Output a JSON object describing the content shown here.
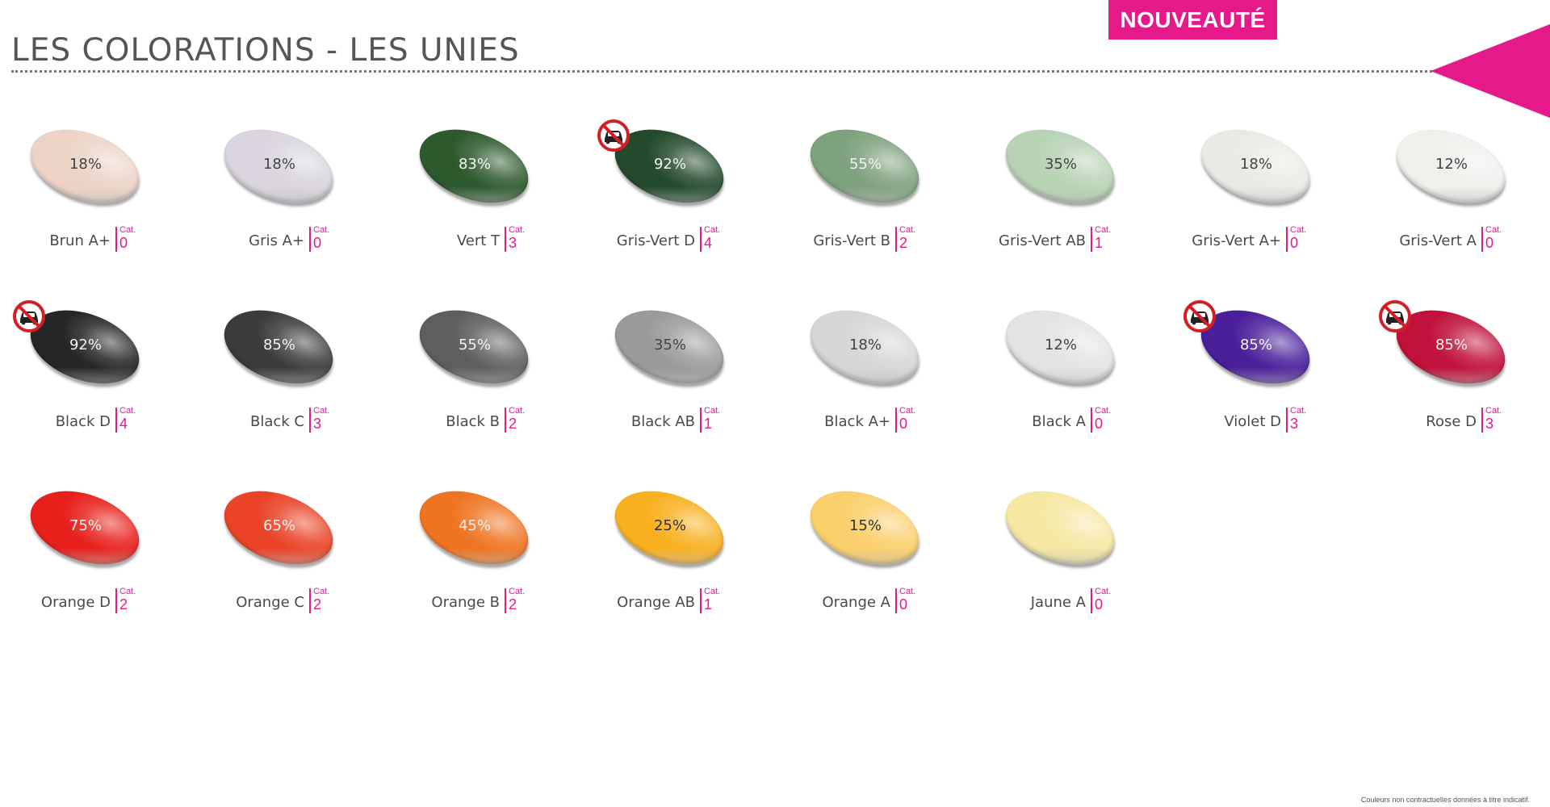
{
  "header": {
    "title": "LES COLORATIONS - LES UNIES",
    "badge": "NOUVEAUTÉ"
  },
  "cat_label": "Cat.",
  "colors": {
    "accent": "#e6198a"
  },
  "lenses": [
    {
      "name": "Brun A+",
      "pct": "18%",
      "cat": "0",
      "color": "#ecd3c6",
      "text": "#444",
      "no_driving": false
    },
    {
      "name": "Gris A+",
      "pct": "18%",
      "cat": "0",
      "color": "#d9d4de",
      "text": "#444",
      "no_driving": false
    },
    {
      "name": "Vert T",
      "pct": "83%",
      "cat": "3",
      "color": "#2d5a2d",
      "text": "#f2f2f2",
      "no_driving": false
    },
    {
      "name": "Gris-Vert D",
      "pct": "92%",
      "cat": "4",
      "color": "#244a2c",
      "text": "#f2f2f2",
      "no_driving": true
    },
    {
      "name": "Gris-Vert B",
      "pct": "55%",
      "cat": "2",
      "color": "#7ea27e",
      "text": "#f2f2f2",
      "no_driving": false
    },
    {
      "name": "Gris-Vert AB",
      "pct": "35%",
      "cat": "1",
      "color": "#b8d3b4",
      "text": "#444",
      "no_driving": false
    },
    {
      "name": "Gris-Vert A+",
      "pct": "18%",
      "cat": "0",
      "color": "#e8ebe4",
      "text": "#444",
      "no_driving": false
    },
    {
      "name": "Gris-Vert A",
      "pct": "12%",
      "cat": "0",
      "color": "#f1efec",
      "text": "#444",
      "no_driving": false
    },
    {
      "name": "Black D",
      "pct": "92%",
      "cat": "4",
      "color": "#262626",
      "text": "#f2f2f2",
      "no_driving": true
    },
    {
      "name": "Black C",
      "pct": "85%",
      "cat": "3",
      "color": "#3b3b3b",
      "text": "#f2f2f2",
      "no_driving": false
    },
    {
      "name": "Black B",
      "pct": "55%",
      "cat": "2",
      "color": "#5e5e5e",
      "text": "#f2f2f2",
      "no_driving": false
    },
    {
      "name": "Black AB",
      "pct": "35%",
      "cat": "1",
      "color": "#9a9a9a",
      "text": "#444",
      "no_driving": false
    },
    {
      "name": "Black A+",
      "pct": "18%",
      "cat": "0",
      "color": "#d6d6d8",
      "text": "#444",
      "no_driving": false
    },
    {
      "name": "Black A",
      "pct": "12%",
      "cat": "0",
      "color": "#e3e3e3",
      "text": "#444",
      "no_driving": false
    },
    {
      "name": "Violet D",
      "pct": "85%",
      "cat": "3",
      "color": "#4a1f9a",
      "text": "#f2f2f2",
      "no_driving": true
    },
    {
      "name": "Rose D",
      "pct": "85%",
      "cat": "3",
      "color": "#c0123a",
      "text": "#f2f2f2",
      "no_driving": true
    },
    {
      "name": "Orange D",
      "pct": "75%",
      "cat": "2",
      "color": "#e8201b",
      "text": "#f2f2f2",
      "no_driving": false
    },
    {
      "name": "Orange C",
      "pct": "65%",
      "cat": "2",
      "color": "#ea4327",
      "text": "#f2f2f2",
      "no_driving": false
    },
    {
      "name": "Orange B",
      "pct": "45%",
      "cat": "2",
      "color": "#ef7421",
      "text": "#f2f2f2",
      "no_driving": false
    },
    {
      "name": "Orange AB",
      "pct": "25%",
      "cat": "1",
      "color": "#f8b01f",
      "text": "#333",
      "no_driving": false
    },
    {
      "name": "Orange A",
      "pct": "15%",
      "cat": "0",
      "color": "#fbcf6c",
      "text": "#333",
      "no_driving": false
    },
    {
      "name": "Jaune A",
      "pct": "",
      "cat": "0",
      "color": "#f6e7a3",
      "text": "#333",
      "no_driving": false
    }
  ],
  "footnote": "Couleurs non contractuelles données à titre indicatif."
}
